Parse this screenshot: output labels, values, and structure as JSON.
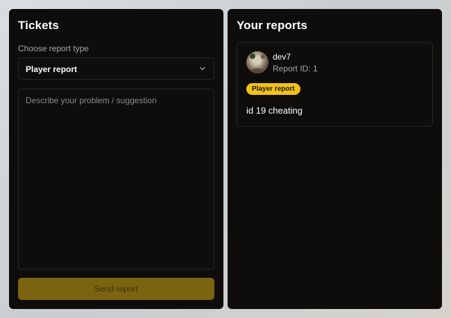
{
  "tickets": {
    "title": "Tickets",
    "report_type_label": "Choose report type",
    "report_type_selected": "Player report",
    "description_placeholder": "Describe your problem / suggestion",
    "send_button_label": "Send report"
  },
  "reports": {
    "title": "Your reports",
    "items": [
      {
        "username": "dev7",
        "report_id": "Report ID: 1",
        "type": "Player report",
        "message": "id 19 cheating"
      }
    ]
  },
  "colors": {
    "panel_bg": "#0e0d0c",
    "accent": "#f2c21a",
    "button_disabled": "#7a6410"
  },
  "icons": {
    "select_chevron": "chevron-down-icon"
  }
}
